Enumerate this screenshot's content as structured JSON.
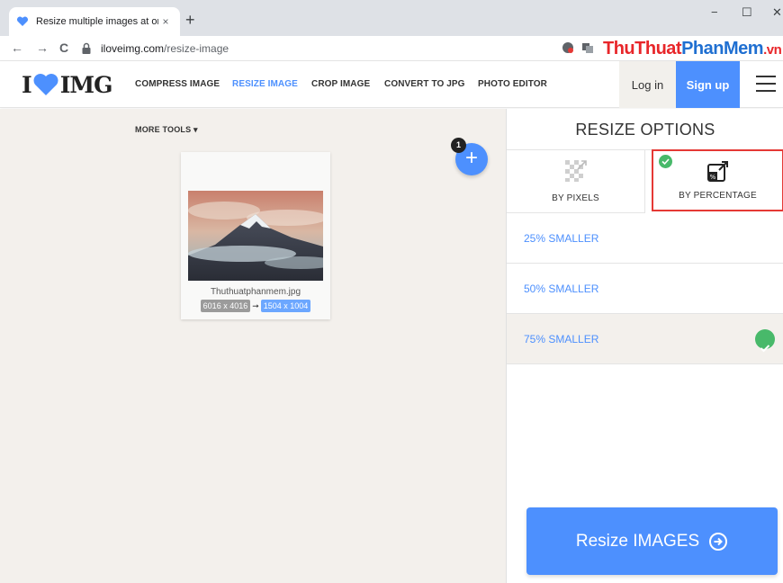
{
  "browser": {
    "tab_title": "Resize multiple images at once!",
    "tab_close": "×",
    "new_tab": "+",
    "minimize": "−",
    "maximize": "☐",
    "close": "✕",
    "back": "←",
    "forward": "→",
    "reload": "C",
    "url_domain": "iloveimg.com",
    "url_path": "/resize-image"
  },
  "watermark": {
    "part1": "Thu",
    "part2": "Thuat",
    "part3": "Phan",
    "part4": "Mem",
    "part5": ".vn"
  },
  "header": {
    "logo_left": "I",
    "logo_right": "IMG",
    "nav": [
      {
        "label": "COMPRESS IMAGE"
      },
      {
        "label": "RESIZE IMAGE"
      },
      {
        "label": "CROP IMAGE"
      },
      {
        "label": "CONVERT TO JPG"
      },
      {
        "label": "PHOTO EDITOR"
      }
    ],
    "login": "Log in",
    "signup": "Sign up"
  },
  "workarea": {
    "more_tools": "MORE TOOLS ▾",
    "add_plus": "+",
    "file_count": "1",
    "file": {
      "name": "Thuthuatphanmem.jpg",
      "original_size": "6016 x 4016",
      "arrow": "➞",
      "new_size": "1504 x 1004"
    }
  },
  "sidebar": {
    "title": "RESIZE OPTIONS",
    "modes": [
      {
        "label": "BY PIXELS",
        "icon": "pixels-grid-icon"
      },
      {
        "label": "BY PERCENTAGE",
        "icon": "percentage-resize-icon",
        "selected": true
      }
    ],
    "options": [
      {
        "label": "25% SMALLER",
        "selected": false
      },
      {
        "label": "50% SMALLER",
        "selected": false
      },
      {
        "label": "75% SMALLER",
        "selected": true
      }
    ],
    "action_button": "Resize IMAGES"
  },
  "colors": {
    "accent": "#4d90fe",
    "success": "#48b96a",
    "highlight_border": "#e53935",
    "workarea_bg": "#f3f0ec"
  }
}
